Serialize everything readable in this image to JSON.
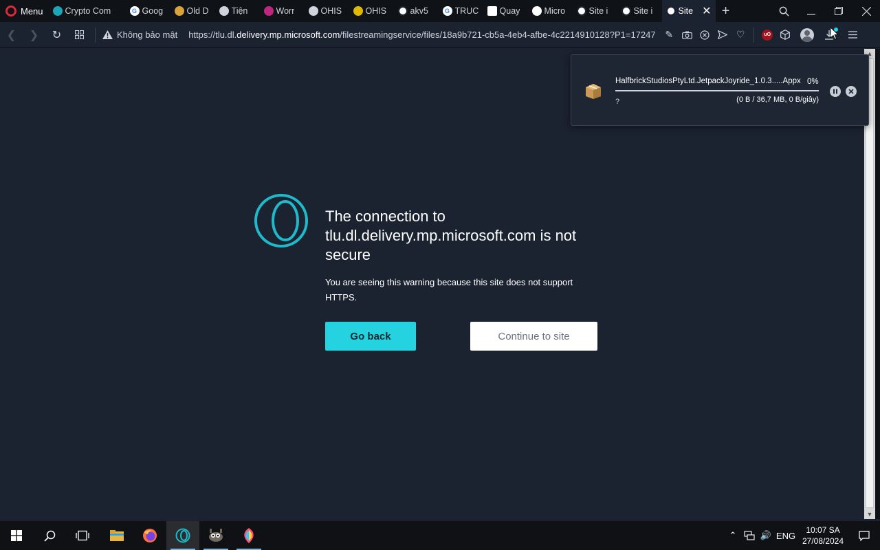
{
  "browser": {
    "menu_label": "Menu",
    "tabs": [
      {
        "label": "Crypto Com",
        "icon": "crypto-icon",
        "color": "#1aa6b7"
      },
      {
        "label": "Goog",
        "icon": "google-icon",
        "color": "#ffffff"
      },
      {
        "label": "Old D",
        "icon": "coin-icon",
        "color": "#d9a23a"
      },
      {
        "label": "Tiện",
        "icon": "cube-icon",
        "color": "#cfd4dc"
      },
      {
        "label": "Worr",
        "icon": "opera-gx-icon",
        "color": "#c0267d"
      },
      {
        "label": "OHIS",
        "icon": "chat-icon",
        "color": "#cfd4dc"
      },
      {
        "label": "OHIS",
        "icon": "photo-icon",
        "color": "#e0b800"
      },
      {
        "label": "akv5",
        "icon": "globe-icon",
        "color": "#ffffff"
      },
      {
        "label": "TRUC",
        "icon": "google-icon",
        "color": "#ffffff"
      },
      {
        "label": "Quay",
        "icon": "grid-icon",
        "color": "#ffffff"
      },
      {
        "label": "Micro",
        "icon": "bag-icon",
        "color": "#ffffff"
      },
      {
        "label": "Site i",
        "icon": "globe-icon",
        "color": "#ffffff"
      },
      {
        "label": "Site i",
        "icon": "globe-icon",
        "color": "#ffffff"
      },
      {
        "label": "Site",
        "icon": "globe-icon",
        "color": "#ffffff"
      }
    ],
    "security_label": "Không bảo mật",
    "url_prefix": "https://tlu.dl.",
    "url_domain": "delivery.mp.microsoft.com",
    "url_suffix": "/filestreamingservice/files/18a9b721-cb5a-4eb4-afbe-4c2214910128?P1=17247"
  },
  "warning": {
    "title": "The connection to tlu.dl.delivery.mp.microsoft.com is not secure",
    "description": "You are seeing this warning because this site does not support HTTPS.",
    "back_label": "Go back",
    "continue_label": "Continue to site"
  },
  "download": {
    "filename": "HalfbrickStudiosPtyLtd.JetpackJoyride_1.0.3.....Appx",
    "percent": "0%",
    "progress": 0,
    "status": "?",
    "size": "(0 B / 36,7 MB, 0 B/giây)"
  },
  "taskbar": {
    "language": "ENG",
    "time": "10:07 SA",
    "date": "27/08/2024"
  },
  "colors": {
    "accent": "#25d2e0",
    "page_bg": "#1b2230",
    "tabbar_bg": "#0f1318"
  }
}
